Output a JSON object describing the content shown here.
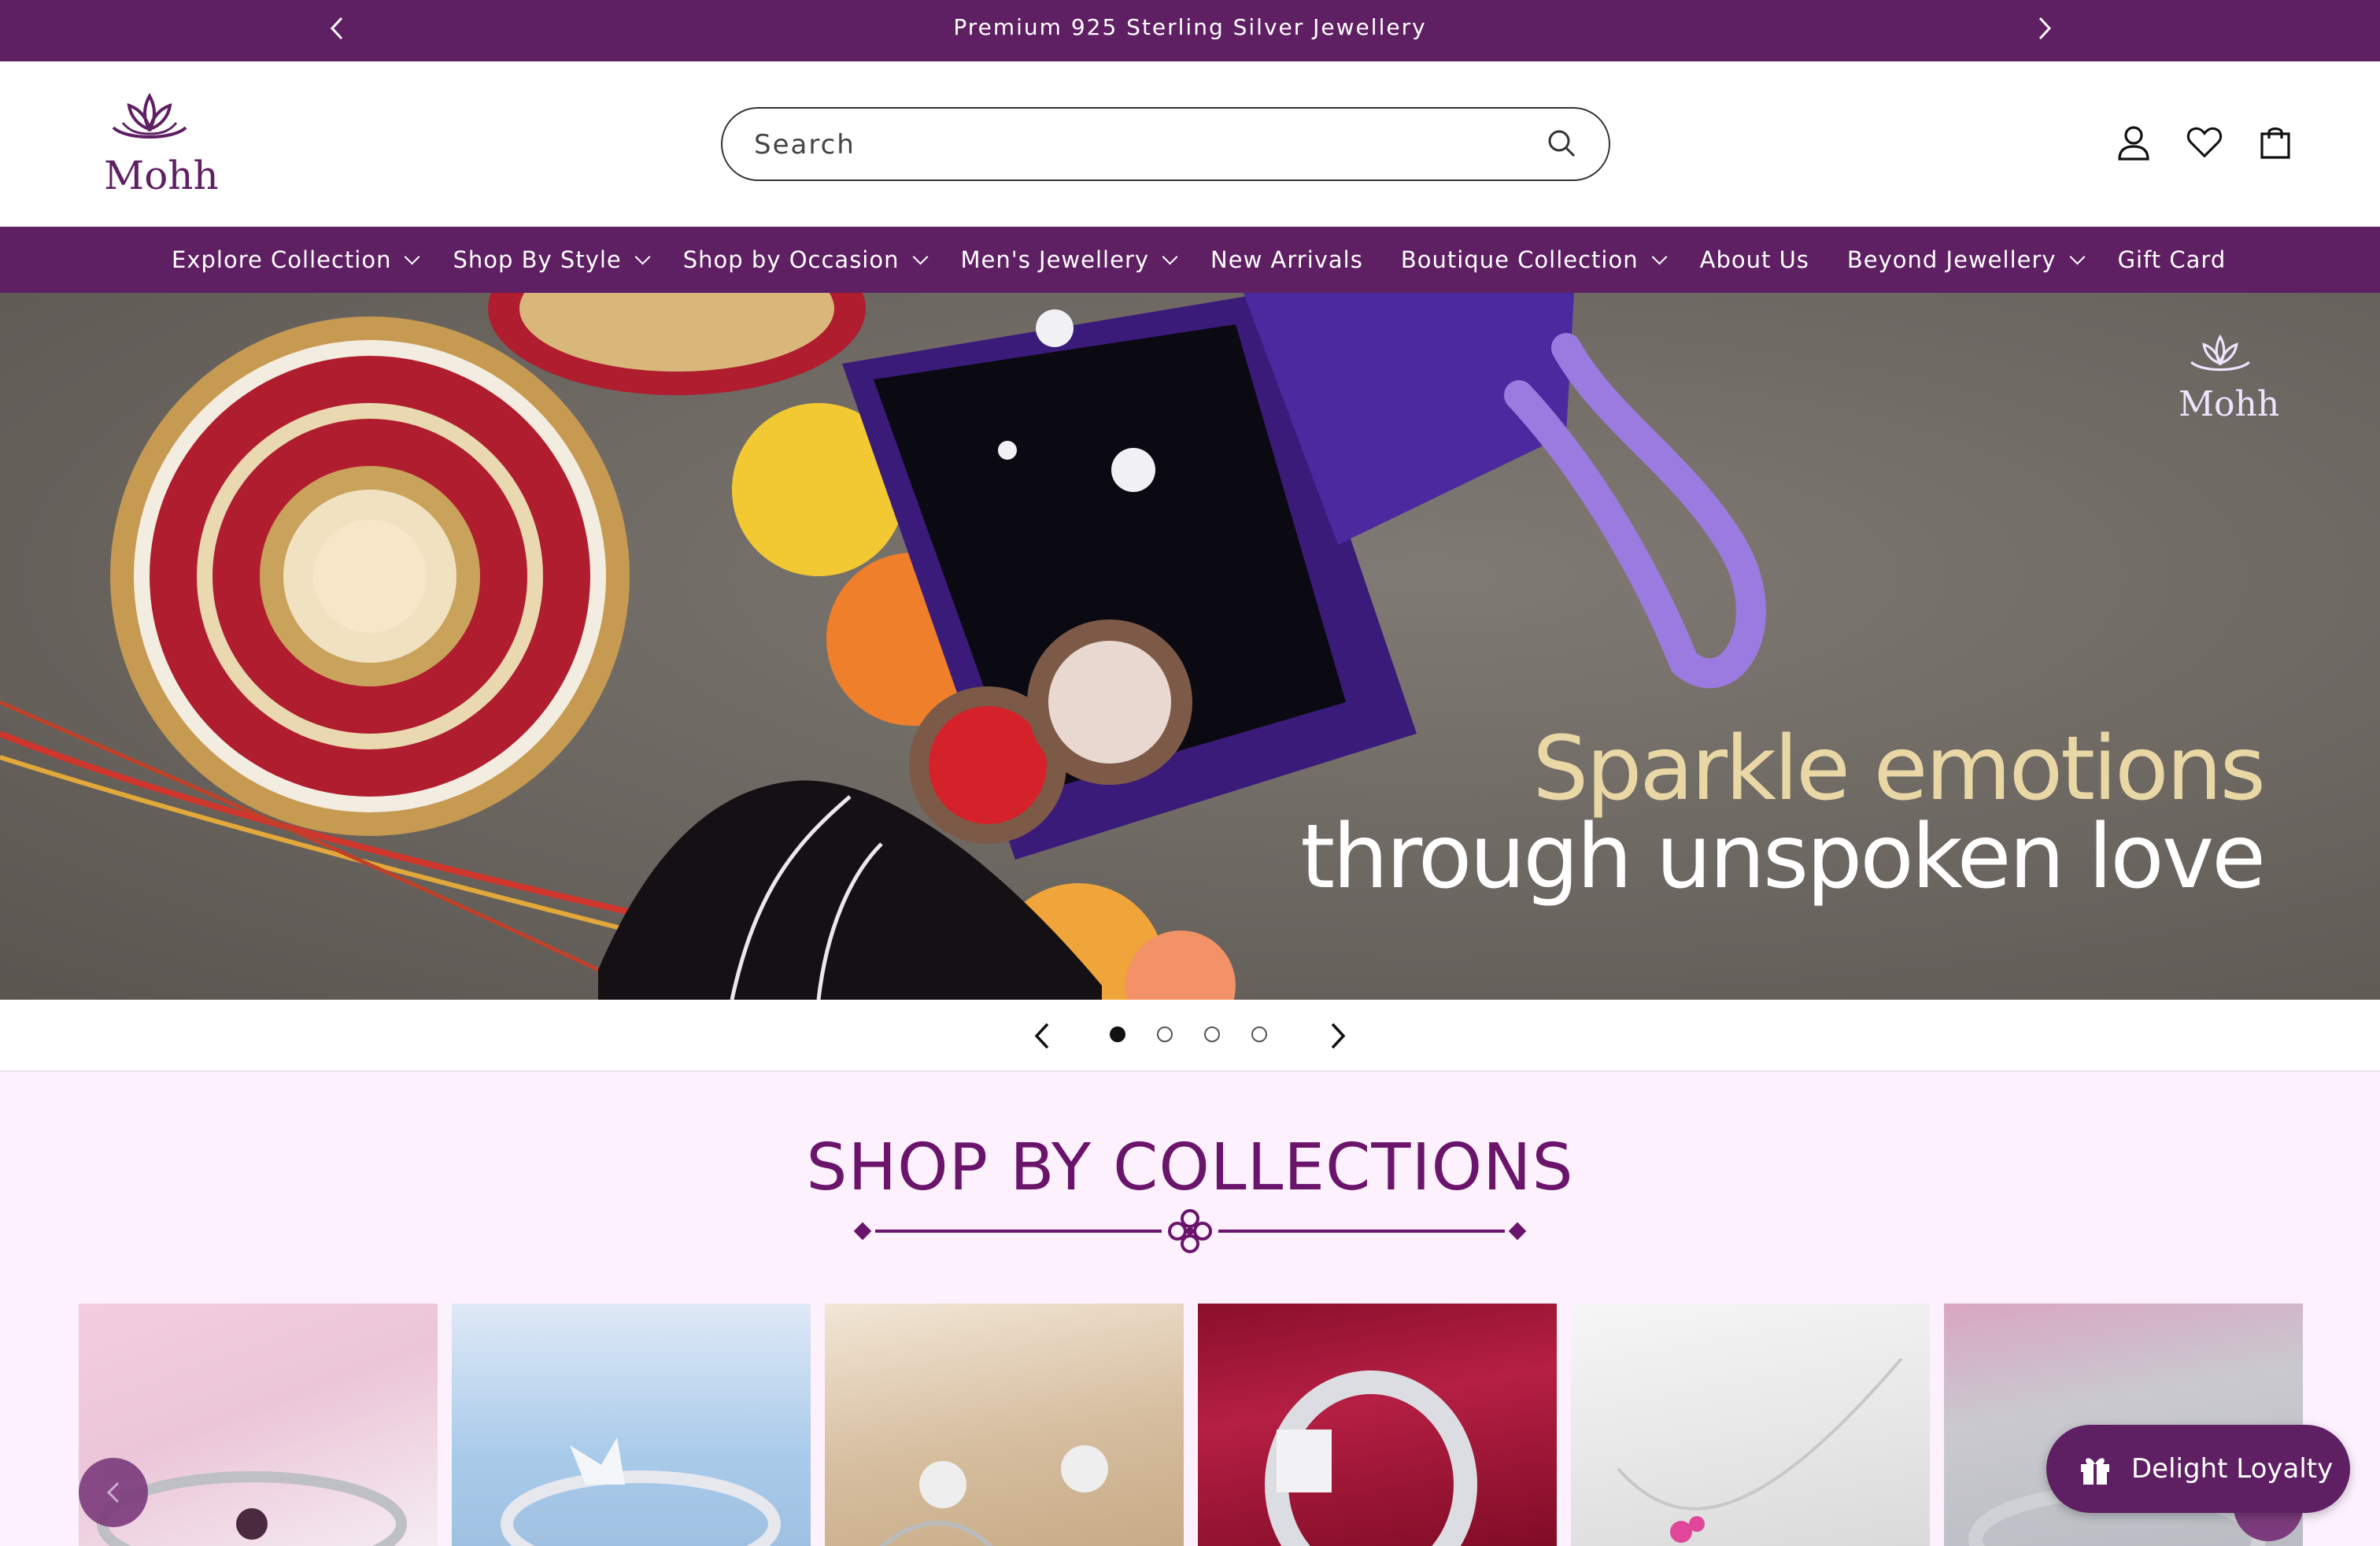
{
  "announcement": {
    "text": "Premium 925 Sterling Silver Jewellery"
  },
  "brand": {
    "name": "Mohh",
    "color": "#5f1f63"
  },
  "search": {
    "placeholder": "Search"
  },
  "header_icons": [
    "account-icon",
    "wishlist-heart-icon",
    "cart-bag-icon"
  ],
  "nav": {
    "items": [
      {
        "label": "Explore Collection",
        "dropdown": true
      },
      {
        "label": "Shop By Style",
        "dropdown": true
      },
      {
        "label": "Shop by Occasion",
        "dropdown": true
      },
      {
        "label": "Men's Jewellery",
        "dropdown": true
      },
      {
        "label": "New Arrivals",
        "dropdown": false
      },
      {
        "label": "Boutique Collection",
        "dropdown": true
      },
      {
        "label": "About Us",
        "dropdown": false
      },
      {
        "label": "Beyond Jewellery",
        "dropdown": true
      },
      {
        "label": "Gift Card",
        "dropdown": false
      }
    ]
  },
  "hero": {
    "headline_line1": "Sparkle emotions",
    "headline_line2": "through unspoken love",
    "watermark": "Mohh",
    "slides_total": 4,
    "active_slide": 1
  },
  "collections": {
    "title": "SHOP BY COLLECTIONS",
    "cards": [
      {
        "name": "bracelet"
      },
      {
        "name": "butterfly-ring"
      },
      {
        "name": "flower-earrings"
      },
      {
        "name": "mens-ring"
      },
      {
        "name": "pendant-necklace"
      },
      {
        "name": "bangle"
      }
    ]
  },
  "loyalty": {
    "label": "Delight Loyalty"
  }
}
